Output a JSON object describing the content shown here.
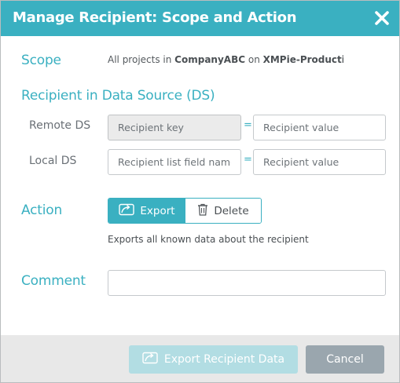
{
  "dialog": {
    "title": "Manage Recipient: Scope and Action",
    "close_icon": "close-icon"
  },
  "scope": {
    "label": "Scope",
    "prefix": "All projects in ",
    "company": "CompanyABC",
    "on": " on ",
    "server": "XMPie-Production"
  },
  "recipient": {
    "section_label": "Recipient in Data Source (DS)",
    "remote_label": "Remote DS",
    "local_label": "Local DS",
    "remote_key_placeholder": "Recipient key",
    "remote_value_placeholder": "Recipient value",
    "local_field_placeholder": "Recipient list field name",
    "local_value_placeholder": "Recipient value",
    "equals": "="
  },
  "action": {
    "label": "Action",
    "options": [
      "Export",
      "Delete"
    ],
    "selected": "Export",
    "export_icon": "export-icon",
    "delete_icon": "trash-icon",
    "hint": "Exports all known data about the recipient"
  },
  "comment": {
    "label": "Comment",
    "value": ""
  },
  "footer": {
    "export_button": "Export Recipient Data",
    "cancel_button": "Cancel"
  },
  "colors": {
    "accent": "#3ab0c1",
    "accent_disabled": "#b2dde3",
    "cancel": "#9aa6ae",
    "footer_bg": "#e8e8e8"
  }
}
